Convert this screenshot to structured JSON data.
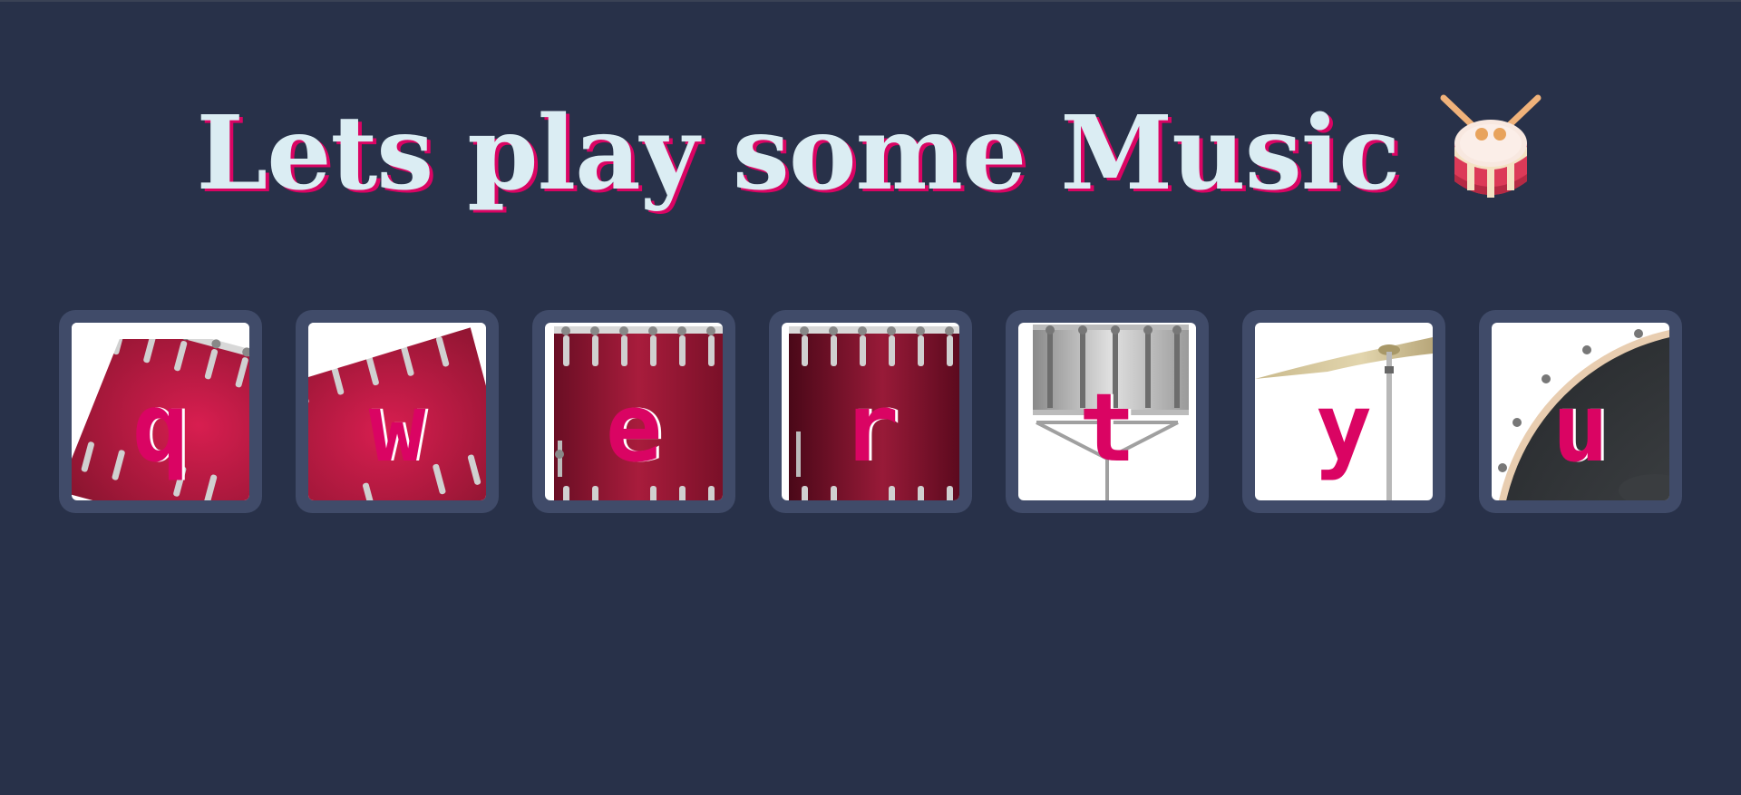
{
  "title": "Lets play some Music",
  "title_icon": "drum-emoji",
  "colors": {
    "background": "#283149",
    "tile": "#404b69",
    "title_text": "#dbedf3",
    "accent": "#da0463"
  },
  "drums": [
    {
      "key": "q",
      "icon": "tom-drum-tilted-left-icon"
    },
    {
      "key": "w",
      "icon": "tom-drum-tilted-right-icon"
    },
    {
      "key": "e",
      "icon": "floor-tom-drum-icon"
    },
    {
      "key": "r",
      "icon": "floor-tom-drum-dark-icon"
    },
    {
      "key": "t",
      "icon": "snare-drum-icon"
    },
    {
      "key": "y",
      "icon": "cymbal-icon"
    },
    {
      "key": "u",
      "icon": "bass-drum-icon"
    }
  ]
}
